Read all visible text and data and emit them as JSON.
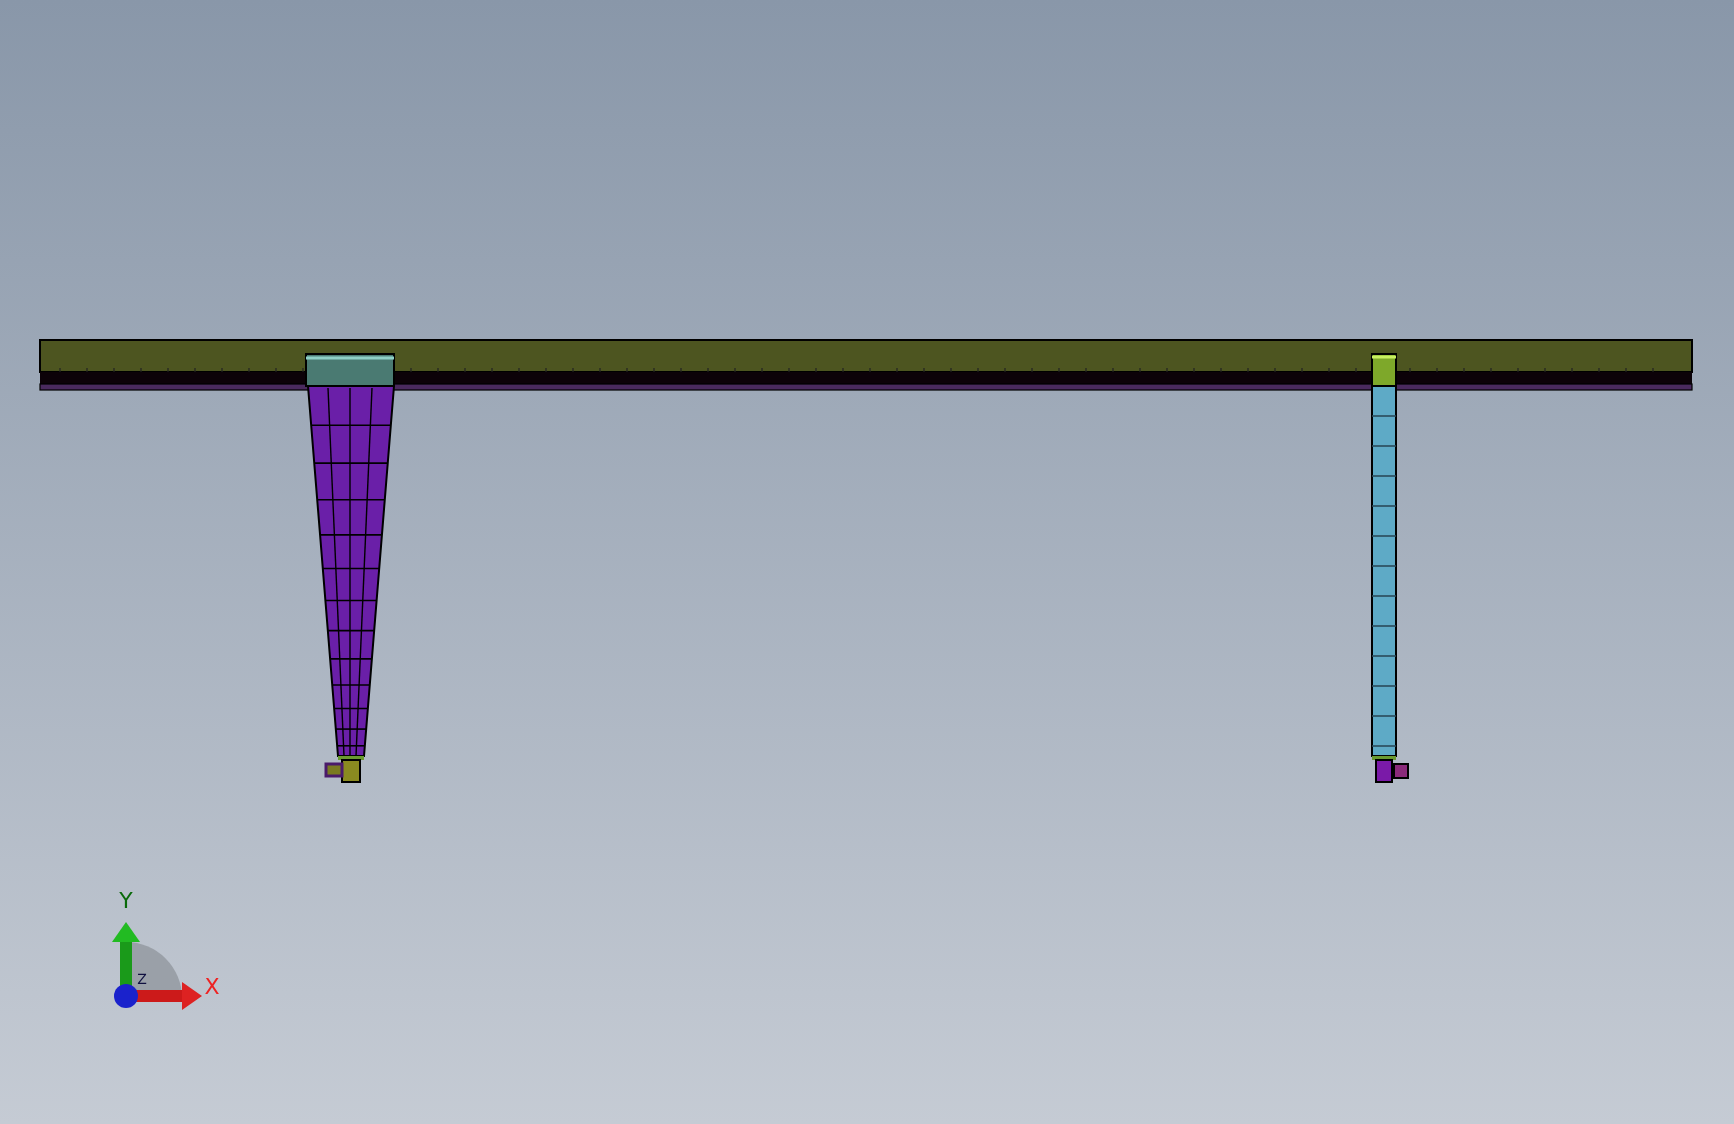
{
  "view_triad": {
    "axes": [
      {
        "kind": "y",
        "label": "Y"
      },
      {
        "kind": "x",
        "label": "X"
      },
      {
        "kind": "z",
        "label": "Z"
      }
    ]
  }
}
